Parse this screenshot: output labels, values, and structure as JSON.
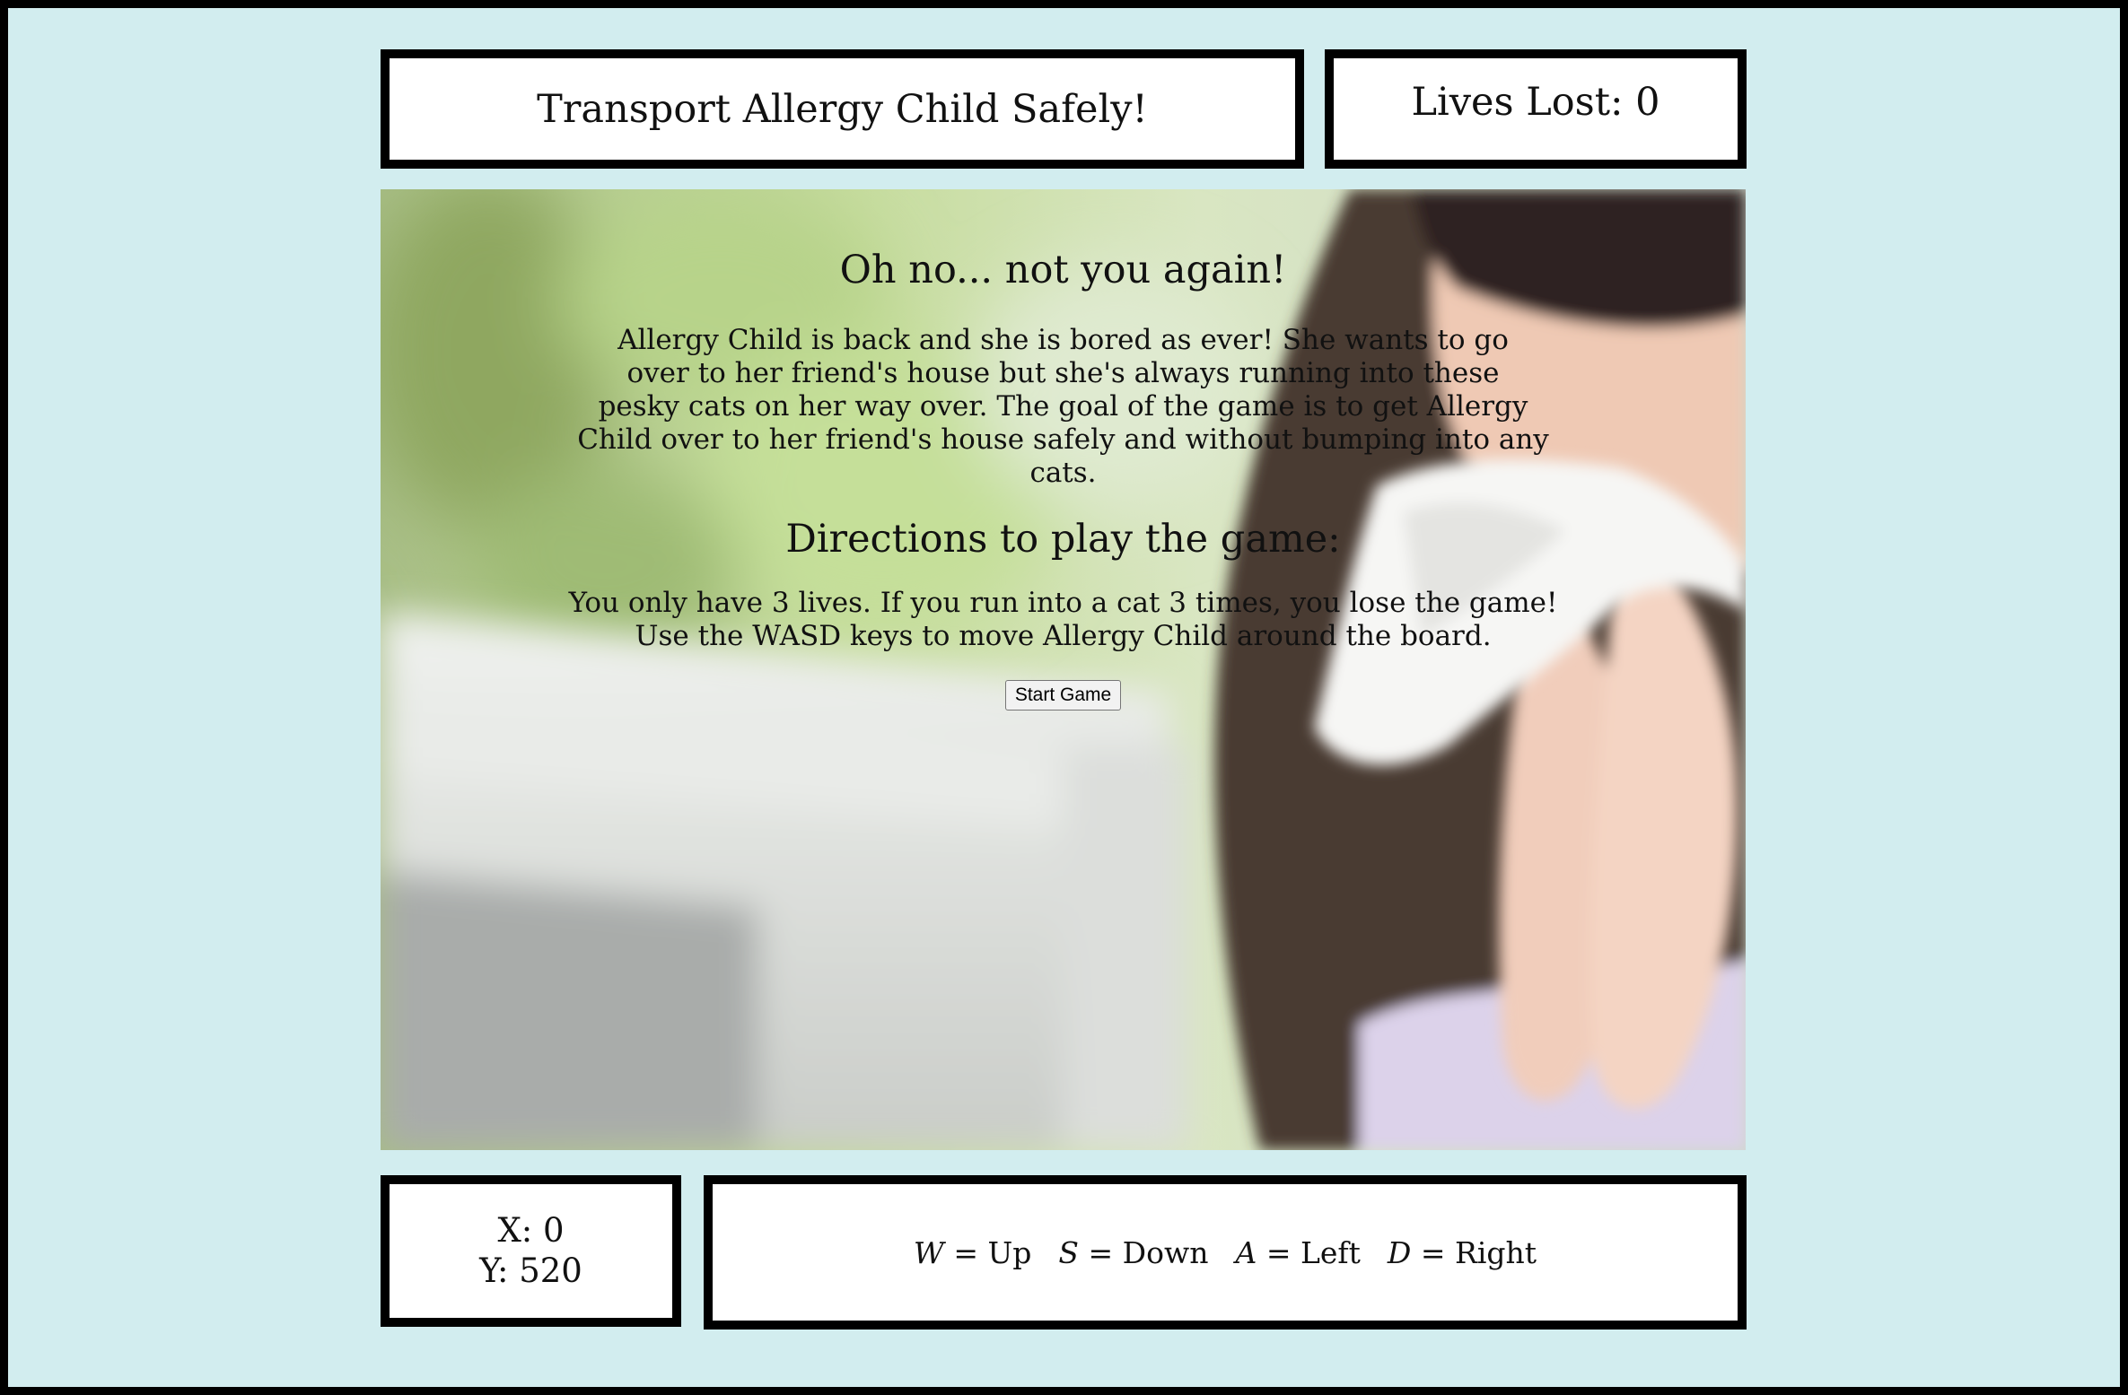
{
  "header": {
    "title": "Transport Allergy Child Safely!",
    "lives_lost": "Lives Lost: 0"
  },
  "board": {
    "background_image": "girl-sneezing-into-tissue-photo",
    "intro": {
      "heading": "Oh no... not you again!",
      "lines": [
        "Allergy Child is back and she is bored as ever! She wants to go",
        "over to her friend's house but she's always running into these",
        "pesky cats on her way over. The goal of the game is to get Allergy",
        "Child over to her friend's house safely and without bumping into any cats."
      ]
    },
    "directions": {
      "heading": "Directions to play the game:",
      "lines": [
        "You only have 3 lives. If you run into a cat 3 times, you lose the game!",
        "Use the WASD keys to move Allergy Child around the board."
      ]
    },
    "start_button": "Start Game"
  },
  "coordinates": {
    "x": "X: 0",
    "y": "Y: 520"
  },
  "controls": {
    "w": {
      "key": "W",
      "label": "= Up"
    },
    "s": {
      "key": "S",
      "label": "= Down"
    },
    "a": {
      "key": "A",
      "label": "= Left"
    },
    "d": {
      "key": "D",
      "label": "= Right"
    }
  },
  "colors": {
    "page_background": "#d2edef",
    "border": "#000000",
    "box_background": "#ffffff"
  }
}
